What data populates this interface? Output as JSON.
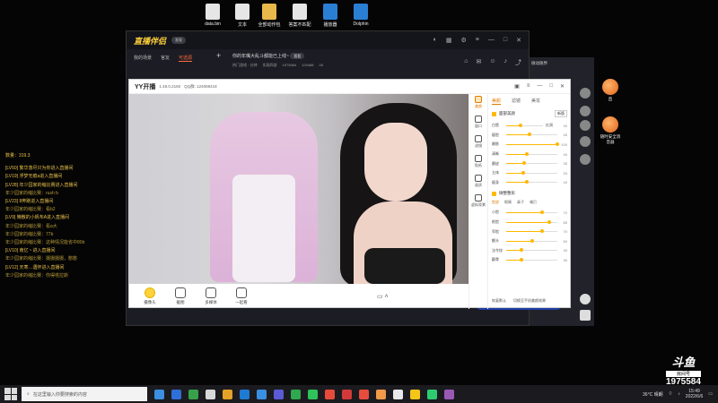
{
  "desktop_icons": [
    {
      "label": "data.bin",
      "color": "#e6e6e6"
    },
    {
      "label": "文本",
      "color": "#e6e6e6"
    },
    {
      "label": "全部动作包",
      "color": "#e8b84a"
    },
    {
      "label": "答案不匹配",
      "color": "#e6e6e6"
    },
    {
      "label": "播放器",
      "color": "#2a7fd4"
    },
    {
      "label": "Dolphin",
      "color": "#2a7fd4"
    }
  ],
  "chat": {
    "count": "数量：319.3",
    "lines": [
      "[LV50] 繁华落尽只为你进入直播间",
      "[LV19] 浮梦无痕a进入直播间",
      "[LV28] 年少园家的缩比赛进入直播间",
      "年少园家的缩比赛：rush b",
      "[LV23] 8奔跑进入直播间",
      "年少园家的缩比赛：看b2",
      "[LV9] 懒散的小帆布A进入直播间",
      "年少园家的缩比赛：看a大",
      "年少园家的缩比赛：77b",
      "年少园家的缩比赛：这种情况能省中80b",
      "[LV10] 南亿丶进入直播间",
      "年少园家的缩比赛：摄摄摄摄，憨憨",
      "[LV12] 天寒…遇怀进入直播间",
      "年少园家的缩比赛：你得塔拉斯"
    ]
  },
  "back_window": {
    "app": "直播伴侣",
    "badge": "发现",
    "tabs": [
      "我的场景",
      "官友",
      "可选源"
    ],
    "active_tab": 2,
    "room_title": "你的年嘴大乱斗都能已上线~",
    "room_tag": "看看",
    "room_meta": [
      "热门游戏 · 分钟",
      "实现四部",
      "1975584",
      "129488",
      "45"
    ],
    "side_label": "微动随界"
  },
  "yy_window": {
    "name": "YY开播",
    "version": "1.48.0.2160",
    "qq": "QQ群: 124088418",
    "bottom_tools": [
      {
        "label": "摄像头",
        "highlight": true
      },
      {
        "label": "截图",
        "highlight": false
      },
      {
        "label": "多媒体",
        "highlight": false
      },
      {
        "label": "一起看",
        "highlight": false
      }
    ],
    "tool_column": [
      {
        "label": "美颜",
        "active": true
      },
      {
        "label": "窗口",
        "active": false
      },
      {
        "label": "滤镜",
        "active": false
      },
      {
        "label": "贴纸",
        "active": false
      },
      {
        "label": "画质",
        "active": false
      },
      {
        "label": "虚拟背景",
        "active": false
      }
    ],
    "panel": {
      "tabs": [
        "美颜",
        "滤镜",
        "美妆"
      ],
      "active_tab": 0,
      "section1": {
        "label": "面部美颜",
        "select": "新版"
      },
      "sliders1": [
        {
          "label": "白皙",
          "value": 40,
          "right": "红润"
        },
        {
          "label": "瘦脸",
          "value": 45
        },
        {
          "label": "嫩肤",
          "value": 100
        },
        {
          "label": "清晰",
          "value": 40
        },
        {
          "label": "磨皮",
          "value": 35
        },
        {
          "label": "立体",
          "value": 33
        },
        {
          "label": "瘦身",
          "value": 40
        }
      ],
      "section2": {
        "label": "微整整形"
      },
      "subtabs": [
        "脸部",
        "眼睛",
        "鼻子",
        "嘴巴"
      ],
      "active_subtab": 0,
      "sliders2": [
        {
          "label": "小脸",
          "value": 70
        },
        {
          "label": "削脸",
          "value": 85
        },
        {
          "label": "窄脸",
          "value": 70
        },
        {
          "label": "额头",
          "value": 50
        },
        {
          "label": "法令纹",
          "value": 30
        },
        {
          "label": "颧骨",
          "value": 30
        }
      ],
      "footer": [
        "恢复默认",
        "切换至手机美颜效果"
      ]
    }
  },
  "right_icons": [
    {
      "label": "直"
    },
    {
      "label": "随时安全消音器"
    }
  ],
  "douyu": {
    "logo": "斗鱼",
    "room_label": "房间号",
    "room_number": "1975584"
  },
  "taskbar": {
    "search_placeholder": "在这里输入你要搜索的内容",
    "apps": [
      "#3b8ee0",
      "#2f6fd8",
      "#37a14a",
      "#d8d8d8",
      "#e3a128",
      "#1f7ad1",
      "#3b8ee0",
      "#5b5bd6",
      "#2fa84f",
      "#2fc25b",
      "#e84a3a",
      "#d23a3a",
      "#e74c3c",
      "#f2994a",
      "#e9e9e9",
      "#f5c518",
      "#2ecc71",
      "#9b59b6"
    ],
    "weather": "36°C 晴朗",
    "time": "15:49",
    "date": "2022/6/6"
  }
}
